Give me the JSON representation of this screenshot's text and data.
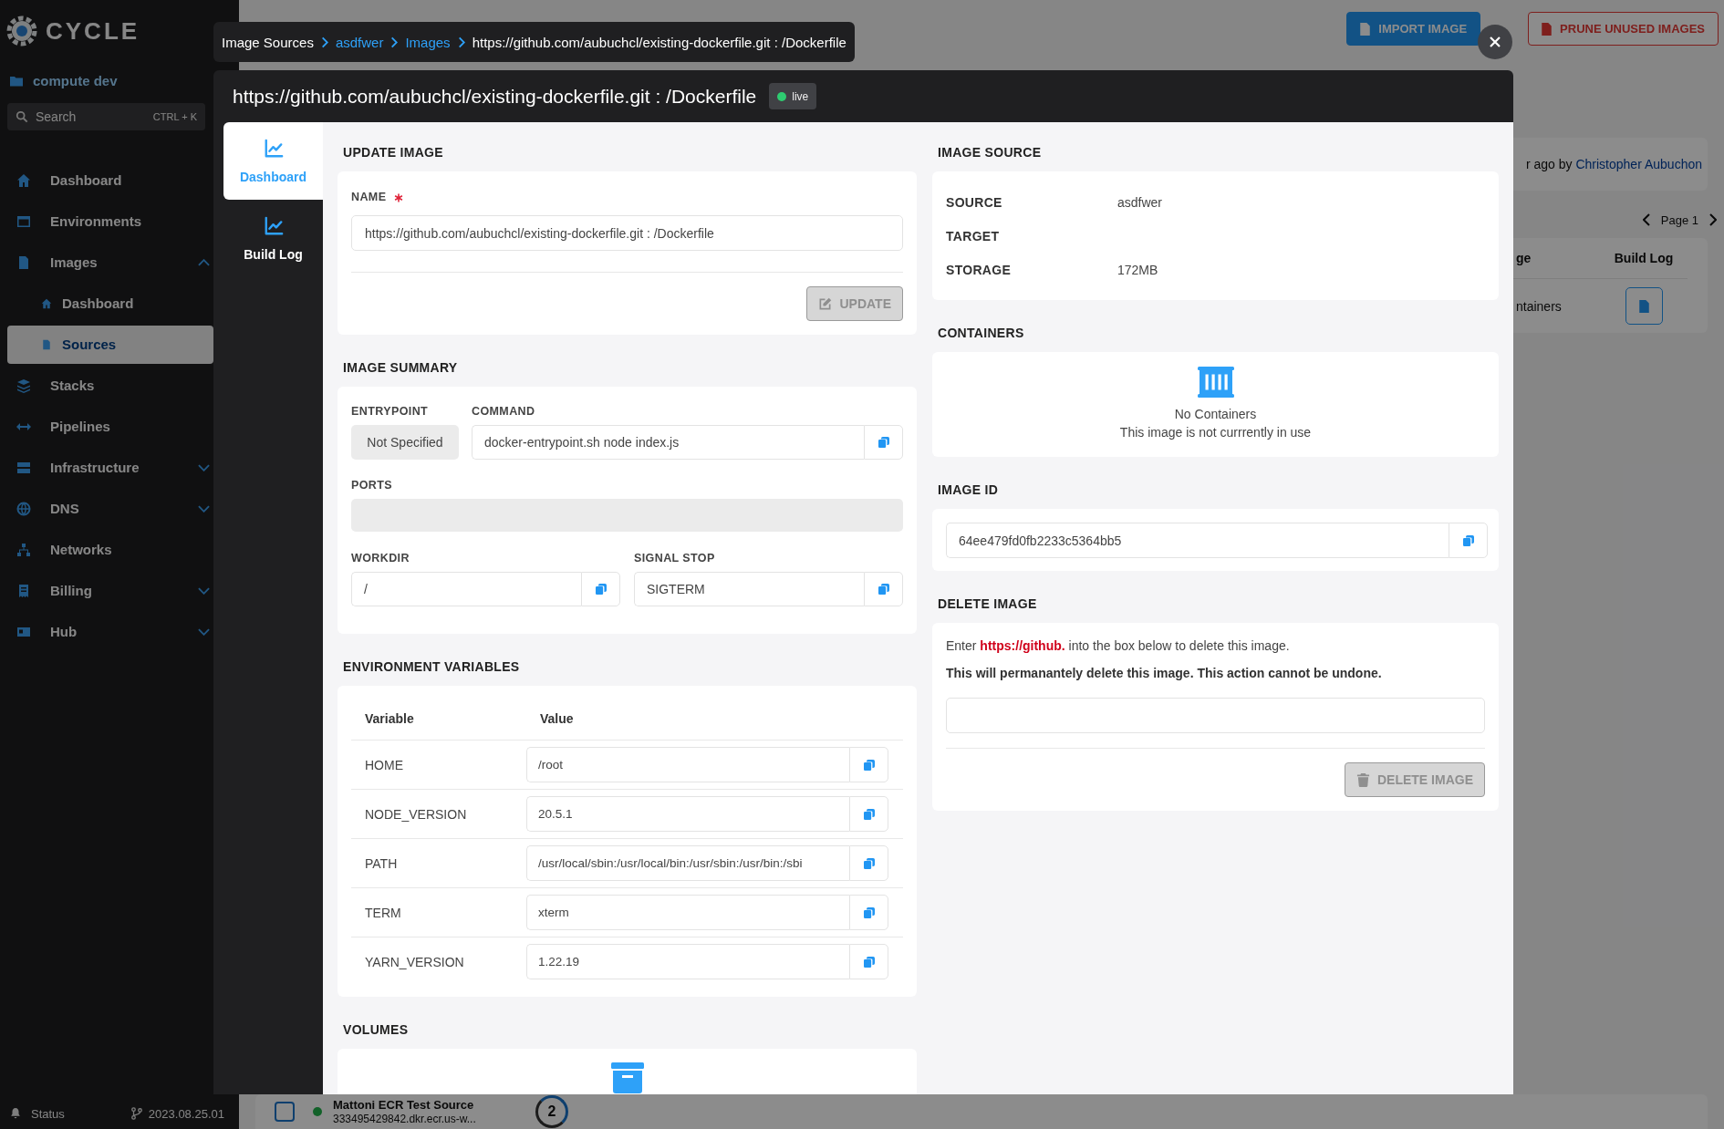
{
  "background": {
    "sidebar": {
      "logo": "CYCLE",
      "hub_link": "compute dev",
      "search": {
        "placeholder": "Search",
        "shortcut": "CTRL + K"
      },
      "nav": [
        {
          "label": "Dashboard",
          "kind": "link",
          "selected": false
        },
        {
          "label": "Environments",
          "kind": "link",
          "selected": false
        },
        {
          "label": "Images",
          "kind": "group",
          "selected": false,
          "expanded": true,
          "children": [
            {
              "label": "Dashboard",
              "selected": false
            },
            {
              "label": "Sources",
              "selected": true
            }
          ]
        },
        {
          "label": "Stacks",
          "kind": "link",
          "selected": false
        },
        {
          "label": "Pipelines",
          "kind": "link",
          "selected": false
        },
        {
          "label": "Infrastructure",
          "kind": "group",
          "selected": false,
          "expanded": false
        },
        {
          "label": "DNS",
          "kind": "group",
          "selected": false,
          "expanded": false
        },
        {
          "label": "Networks",
          "kind": "link",
          "selected": false
        },
        {
          "label": "Billing",
          "kind": "group",
          "selected": false,
          "expanded": false
        },
        {
          "label": "Hub",
          "kind": "group",
          "selected": false,
          "expanded": false
        }
      ],
      "footer": {
        "status": "Status",
        "version": "2023.08.25.01"
      }
    },
    "toolbar": {
      "buttons": [
        {
          "label": "IMPORT IMAGE",
          "kind": "primary"
        },
        {
          "label": "PRUNE UNUSED IMAGES",
          "kind": "danger"
        }
      ]
    },
    "activity": {
      "text": "r ago by",
      "author": "Christopher Aubuchon"
    },
    "pager": {
      "label": "Page 1"
    },
    "table": {
      "columns": [
        "ge",
        "Build Log"
      ],
      "rows": [
        {
          "column_1": "ntainers"
        }
      ]
    },
    "source_row": {
      "checked": false,
      "title": "Mattoni ECR Test Source",
      "subtitle": "333495429842.dkr.ecr.us-w...",
      "count": "2"
    }
  },
  "breadcrumb": [
    {
      "label": "Image Sources",
      "kind": "root"
    },
    {
      "label": "asdfwer",
      "kind": "link"
    },
    {
      "label": "Images",
      "kind": "link"
    },
    {
      "label": "https://github.com/aubuchcl/existing-dockerfile.git : /Dockerfile",
      "kind": "current"
    }
  ],
  "modal": {
    "title": "https://github.com/aubuchcl/existing-dockerfile.git : /Dockerfile",
    "status_badge": {
      "label": "live"
    },
    "tabs": [
      {
        "label": "Dashboard",
        "selected": true
      },
      {
        "label": "Build Log",
        "selected": false
      }
    ],
    "update_image": {
      "heading": "UPDATE IMAGE",
      "name_label": "NAME",
      "required": true,
      "name_value": "https://github.com/aubuchcl/existing-dockerfile.git : /Dockerfile",
      "button": {
        "label": "UPDATE",
        "disabled": true
      }
    },
    "image_summary": {
      "heading": "IMAGE SUMMARY",
      "entrypoint": {
        "label": "ENTRYPOINT",
        "value": "Not Specified"
      },
      "command": {
        "label": "COMMAND",
        "value": "docker-entrypoint.sh node index.js"
      },
      "ports": {
        "label": "PORTS"
      },
      "workdir": {
        "label": "WORKDIR",
        "value": "/"
      },
      "signal_stop": {
        "label": "SIGNAL STOP",
        "value": "SIGTERM"
      }
    },
    "environment_variables": {
      "heading": "ENVIRONMENT VARIABLES",
      "columns": [
        "Variable",
        "Value"
      ],
      "rows": [
        {
          "variable": "HOME",
          "value": "/root"
        },
        {
          "variable": "NODE_VERSION",
          "value": "20.5.1"
        },
        {
          "variable": "PATH",
          "value": "/usr/local/sbin:/usr/local/bin:/usr/sbin:/usr/bin:/sbi"
        },
        {
          "variable": "TERM",
          "value": "xterm"
        },
        {
          "variable": "YARN_VERSION",
          "value": "1.22.19"
        }
      ]
    },
    "volumes": {
      "heading": "VOLUMES"
    },
    "image_source": {
      "heading": "IMAGE SOURCE",
      "rows": [
        {
          "label": "SOURCE",
          "value": "asdfwer"
        },
        {
          "label": "TARGET"
        },
        {
          "label": "STORAGE",
          "value": "172MB"
        }
      ]
    },
    "containers": {
      "heading": "CONTAINERS",
      "empty_title": "No Containers",
      "empty_text": "This image is not currrently in use"
    },
    "image_id": {
      "heading": "IMAGE ID",
      "value": "64ee479fd0fb2233c5364bb5"
    },
    "delete_image": {
      "heading": "DELETE IMAGE",
      "instructions": "Enter **https://github.** into the box below to delete this image.",
      "warning": "This will permanantely delete this image. This action cannot be undone.",
      "button": {
        "label": "DELETE IMAGE",
        "disabled": true
      }
    }
  }
}
